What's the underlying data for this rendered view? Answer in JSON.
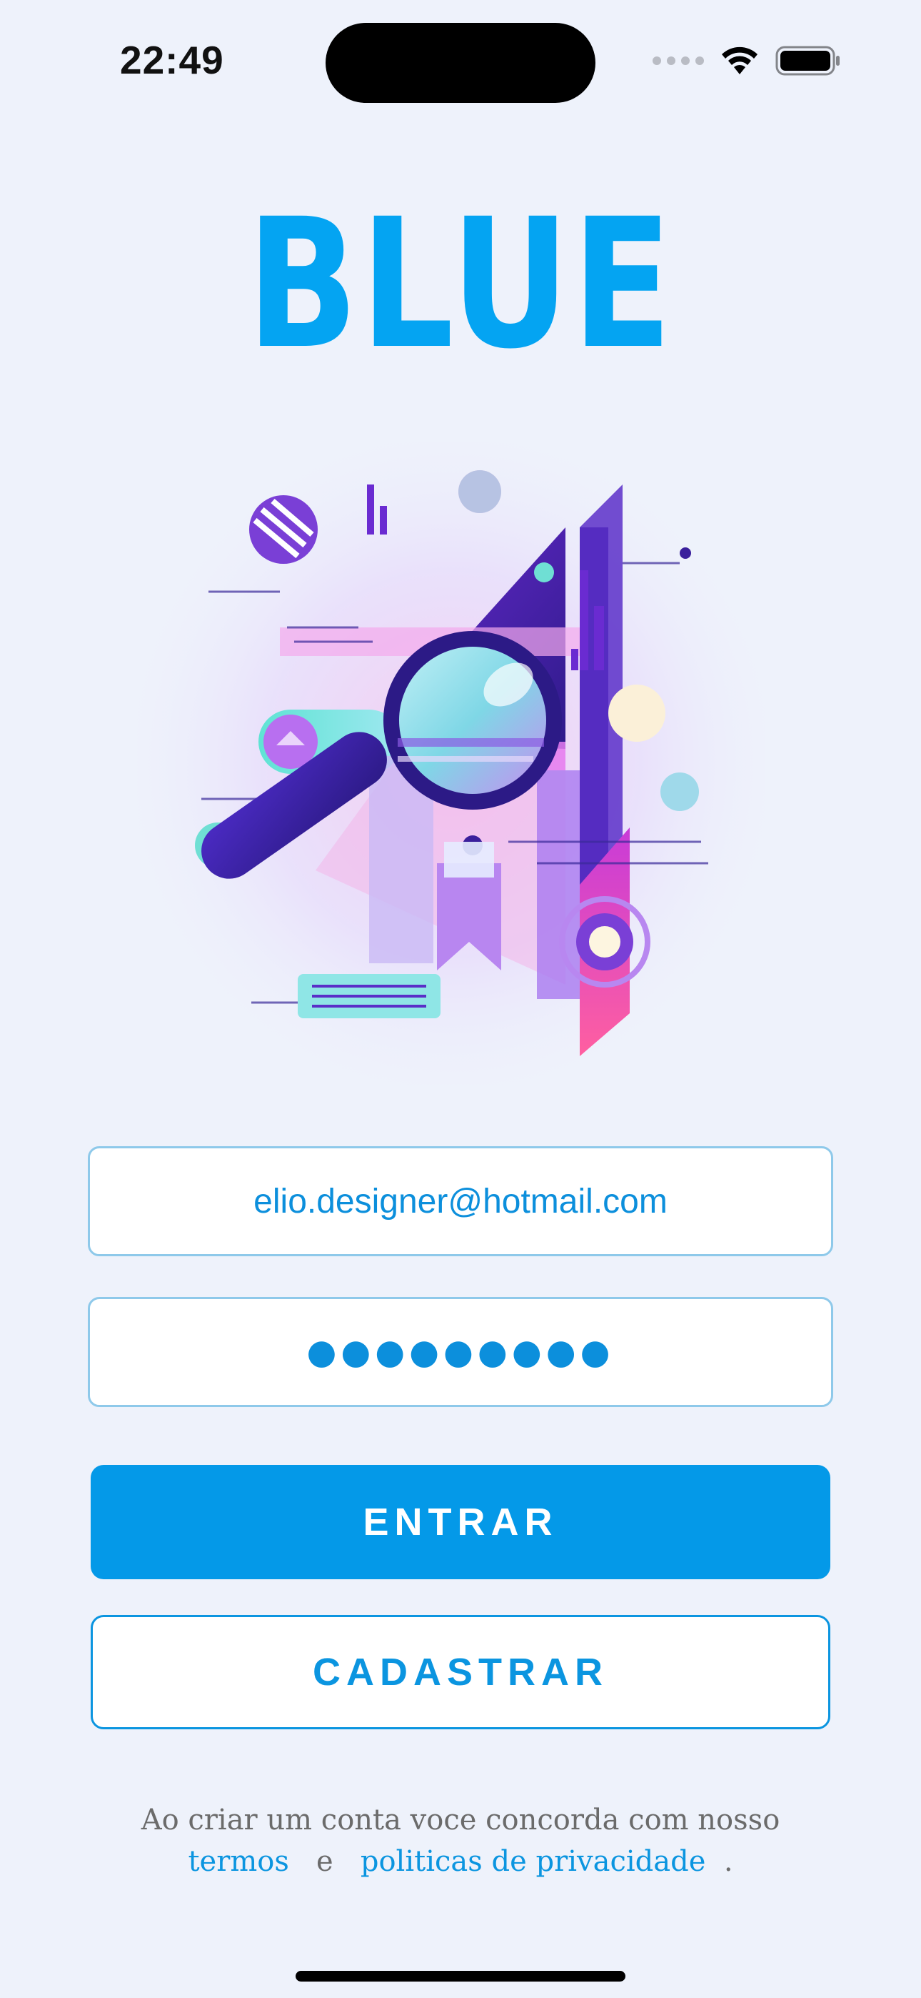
{
  "status_bar": {
    "time": "22:49",
    "wifi_icon": "wifi-icon",
    "battery_icon": "battery-icon"
  },
  "brand": {
    "name": "BLUE",
    "color": "#04a4f2"
  },
  "illustration": {
    "icon": "magnifying-glass-illustration"
  },
  "login_form": {
    "email_value": "elio.designer@hotmail.com",
    "password_masked": "●●●●●●●●●",
    "login_button": "ENTRAR",
    "register_button": "CADASTRAR"
  },
  "terms": {
    "line1": "Ao criar um conta voce concorda com nosso",
    "terms_link": "termos",
    "and": "e",
    "privacy_link": "politicas de privacidade",
    "period": "."
  },
  "colors": {
    "accent": "#0499e8",
    "background": "#eef2fb"
  }
}
